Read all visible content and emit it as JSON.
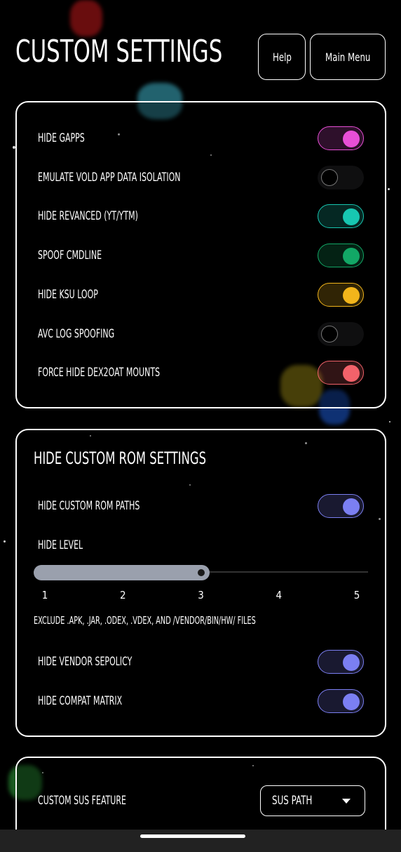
{
  "header": {
    "title": "CUSTOM SETTINGS",
    "help_label": "Help",
    "main_menu_label": "Main Menu"
  },
  "card1": {
    "items": [
      {
        "label": "HIDE GAPPS",
        "on": true,
        "color": "#e84fd7"
      },
      {
        "label": "EMULATE VOLD APP DATA ISOLATION",
        "on": false,
        "color": "#2a2a2a"
      },
      {
        "label": "HIDE REVANCED (YT/YTM)",
        "on": true,
        "color": "#17c7b1"
      },
      {
        "label": "SPOOF CMDLINE",
        "on": true,
        "color": "#12a866"
      },
      {
        "label": "HIDE KSU LOOP",
        "on": true,
        "color": "#f2b51b"
      },
      {
        "label": "AVC LOG SPOOFING",
        "on": false,
        "color": "#2a2a2a"
      },
      {
        "label": "FORCE HIDE DEX2OAT MOUNTS",
        "on": true,
        "color": "#f2626a"
      }
    ]
  },
  "card2": {
    "title": "HIDE CUSTOM ROM SETTINGS",
    "hide_paths_label": "HIDE CUSTOM ROM PATHS",
    "hide_paths_on": true,
    "hide_level_label": "HIDE LEVEL",
    "hide_level_value": 3,
    "hide_level_ticks": [
      "1",
      "2",
      "3",
      "4",
      "5"
    ],
    "note": "EXCLUDE .APK, .JAR, .ODEX, .VDEX, AND /VENDOR/BIN/HW/ FILES",
    "vendor_sepolicy_label": "HIDE VENDOR SEPOLICY",
    "vendor_sepolicy_on": true,
    "compat_matrix_label": "HIDE COMPAT MATRIX",
    "compat_matrix_on": true,
    "accent": "#7b7ff2"
  },
  "card3": {
    "label": "CUSTOM SUS FEATURE",
    "select_value": "SUS PATH"
  }
}
